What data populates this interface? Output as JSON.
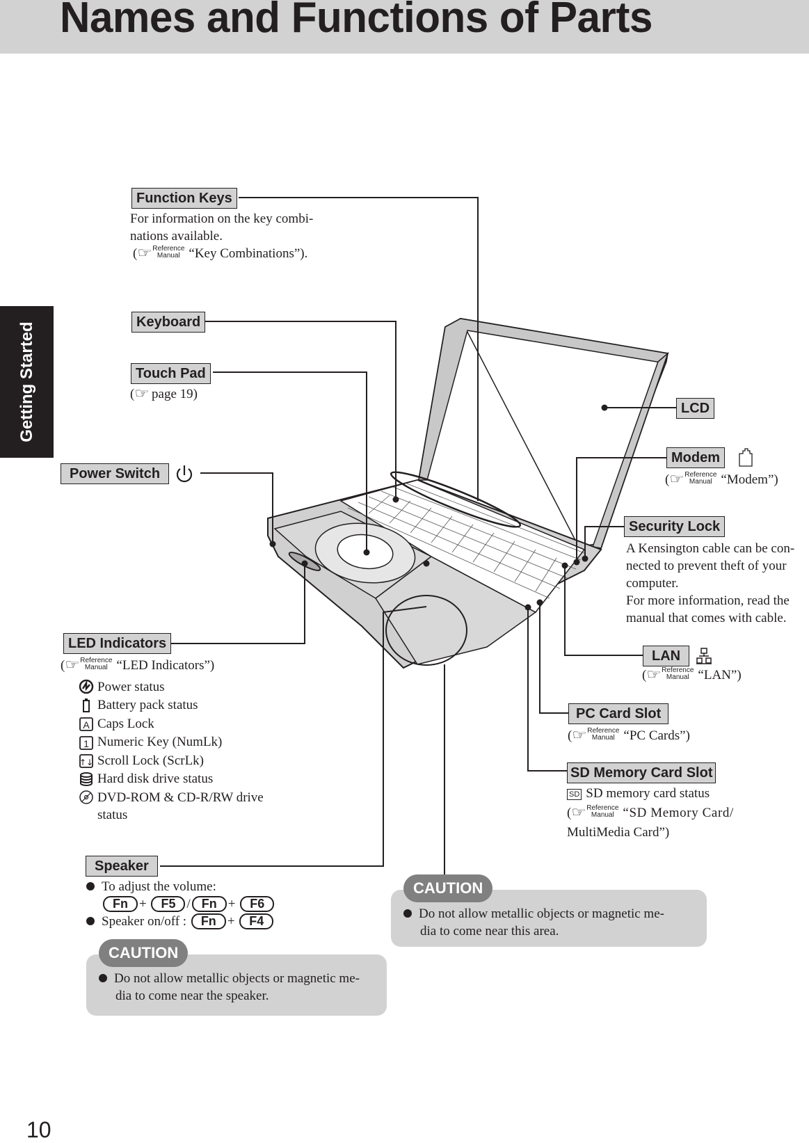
{
  "header": {
    "title": "Names and Functions of Parts"
  },
  "side_tab": {
    "label": "Getting Started"
  },
  "page_number": "10",
  "reference_badge": {
    "line1": "Reference",
    "line2": "Manual"
  },
  "parts": {
    "function_keys": {
      "label": "Function Keys",
      "desc_line1": "For information on the key combi-",
      "desc_line2": "nations available.",
      "ref": "“Key Combinations”)."
    },
    "keyboard": {
      "label": "Keyboard"
    },
    "touch_pad": {
      "label": "Touch Pad",
      "ref": "page 19)"
    },
    "power_switch": {
      "label": "Power Switch",
      "icon": "power-icon"
    },
    "led_indicators": {
      "label": "LED Indicators",
      "ref": "“LED Indicators”)",
      "items": [
        {
          "icon": "power-status-icon",
          "text": "Power status"
        },
        {
          "icon": "battery-icon",
          "text": "Battery pack status"
        },
        {
          "icon": "caps-lock-icon",
          "text": "Caps Lock"
        },
        {
          "icon": "numlock-icon",
          "text": "Numeric Key (NumLk)"
        },
        {
          "icon": "scroll-lock-icon",
          "text": "Scroll Lock (ScrLk)"
        },
        {
          "icon": "hdd-icon",
          "text": "Hard disk drive status"
        },
        {
          "icon": "disc-icon",
          "text": "DVD-ROM & CD-R/RW drive",
          "text2": "status"
        }
      ]
    },
    "speaker": {
      "label": "Speaker",
      "bullet1": "To adjust the volume:",
      "keys_volume": [
        "Fn",
        "+",
        "F5",
        "/",
        "Fn",
        "+",
        "F6"
      ],
      "bullet2": "Speaker on/off :",
      "keys_onoff": [
        "Fn",
        "+",
        "F4"
      ]
    },
    "lcd": {
      "label": "LCD"
    },
    "modem": {
      "label": "Modem",
      "icon": "modem-jack-icon",
      "ref": "“Modem”)"
    },
    "security_lock": {
      "label": "Security Lock",
      "desc": [
        "A Kensington cable can be con-",
        "nected to prevent theft of your",
        "computer.",
        "For more information, read the",
        "manual that comes with cable."
      ]
    },
    "lan": {
      "label": "LAN",
      "icon": "lan-icon",
      "ref": "“LAN”)"
    },
    "pc_card_slot": {
      "label": "PC Card Slot",
      "ref": "“PC Cards”)"
    },
    "sd_card_slot": {
      "label": "SD Memory Card Slot",
      "status_icon": "SD",
      "status": "SD memory card status",
      "ref_line1": "“SD Memory Card/",
      "ref_line2": "MultiMedia Card”)"
    }
  },
  "cautions": [
    {
      "title": "CAUTION",
      "text_line1": "Do not allow metallic objects or magnetic me-",
      "text_line2": "dia to come near the speaker."
    },
    {
      "title": "CAUTION",
      "text_line1": "Do not allow metallic objects or magnetic me-",
      "text_line2": "dia to come near this area."
    }
  ],
  "colors": {
    "label_bg": "#d2d2d2",
    "caution_tab": "#808080",
    "text": "#231f20"
  }
}
